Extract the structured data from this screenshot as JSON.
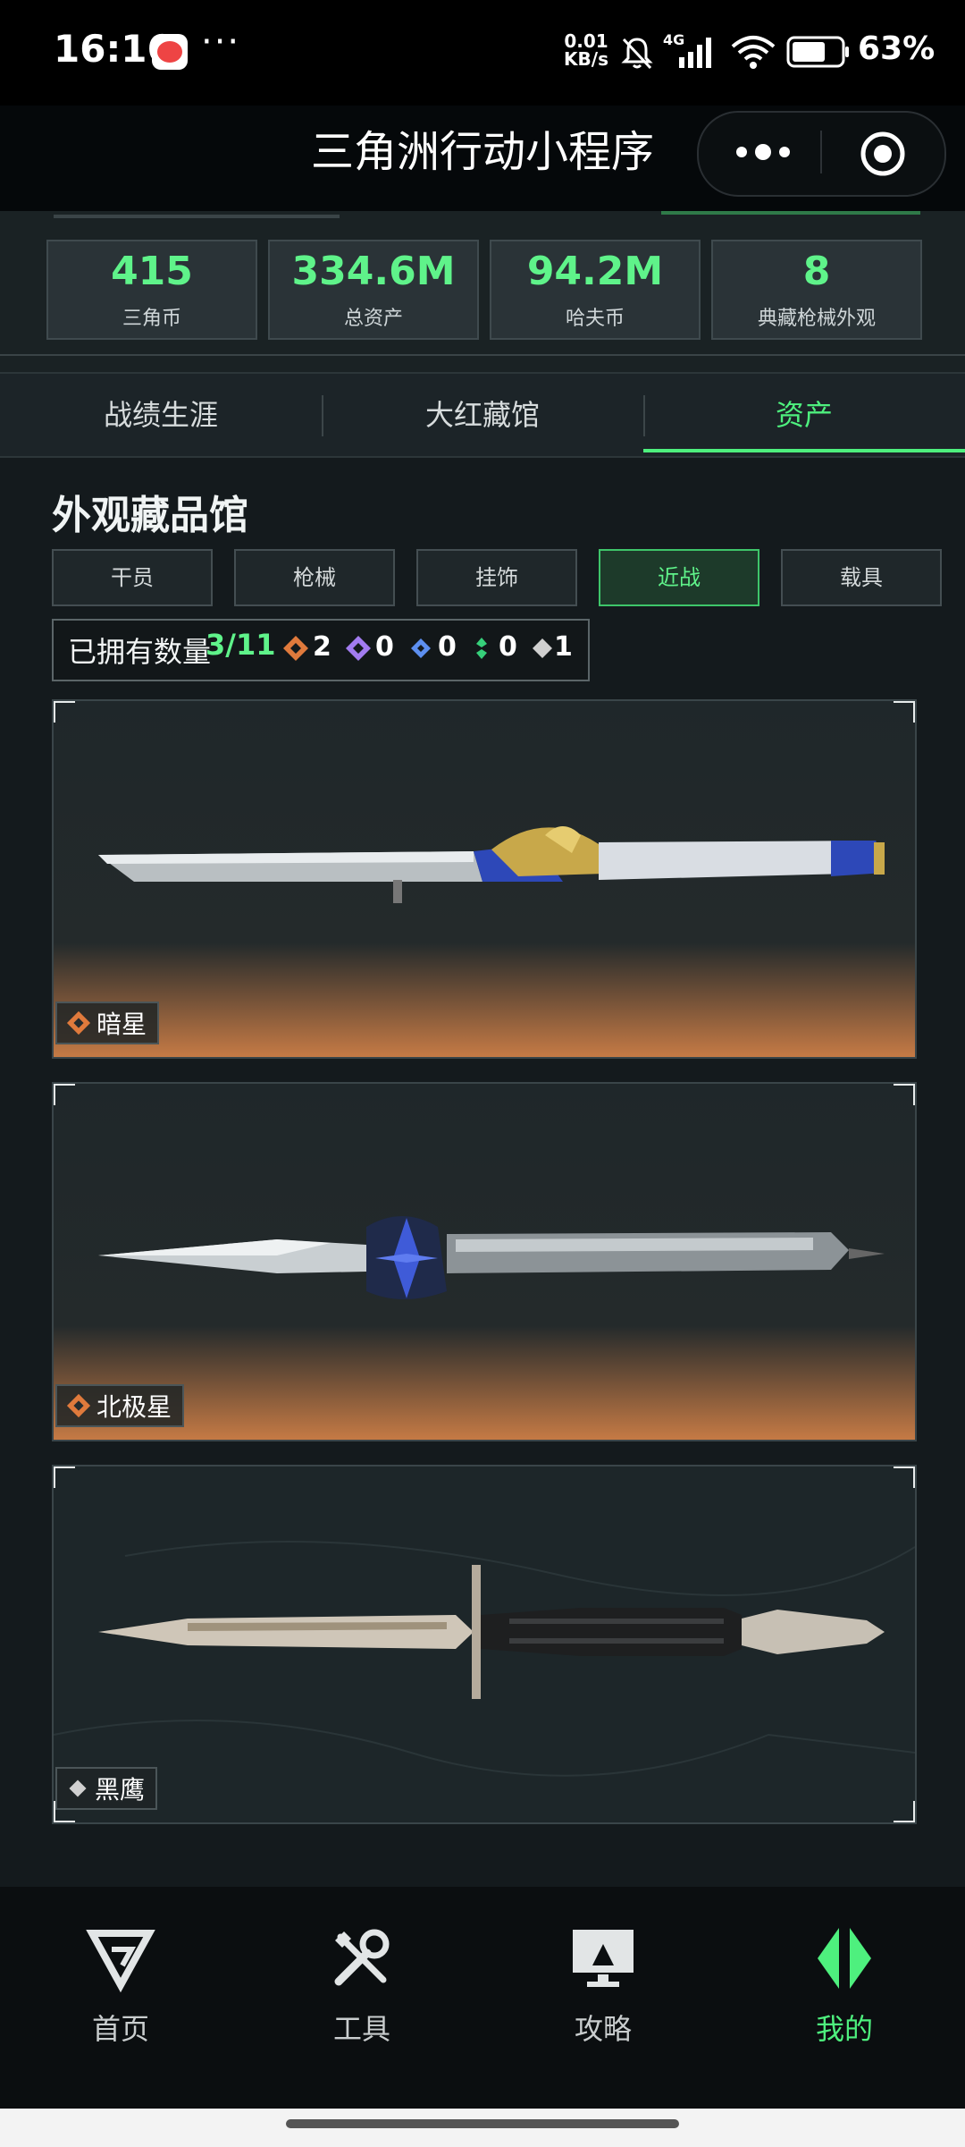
{
  "status_bar": {
    "time": "16:16",
    "dots": "···",
    "net_speed_value": "0.01",
    "net_speed_unit": "KB/s",
    "battery": "63%",
    "network": "4G"
  },
  "header": {
    "title": "三角洲行动小程序"
  },
  "stats": [
    {
      "value": "415",
      "label": "三角币"
    },
    {
      "value": "334.6M",
      "label": "总资产"
    },
    {
      "value": "94.2M",
      "label": "哈夫币"
    },
    {
      "value": "8",
      "label": "典藏枪械外观"
    }
  ],
  "tabs": [
    {
      "label": "战绩生涯"
    },
    {
      "label": "大红藏馆"
    },
    {
      "label": "资产"
    }
  ],
  "section": {
    "title": "外观藏品馆",
    "categories": [
      {
        "label": "干员"
      },
      {
        "label": "枪械"
      },
      {
        "label": "挂饰"
      },
      {
        "label": "近战"
      },
      {
        "label": "载具"
      }
    ],
    "owned_label": "已拥有数量",
    "owned_count": "3/11",
    "rarity_counts": [
      "2",
      "0",
      "0",
      "0",
      "1"
    ]
  },
  "items": [
    {
      "name": "暗星"
    },
    {
      "name": "北极星"
    },
    {
      "name": "黑鹰"
    }
  ],
  "bottom_nav": [
    {
      "label": "首页"
    },
    {
      "label": "工具"
    },
    {
      "label": "攻略"
    },
    {
      "label": "我的"
    }
  ],
  "colors": {
    "accent_green": "#4ef07e",
    "rarity_orange": "#e07a3c",
    "rarity_purple": "#a27cf0",
    "rarity_blue": "#5d8ff0",
    "rarity_green": "#36d07a",
    "rarity_gray": "#d0d0d0"
  }
}
